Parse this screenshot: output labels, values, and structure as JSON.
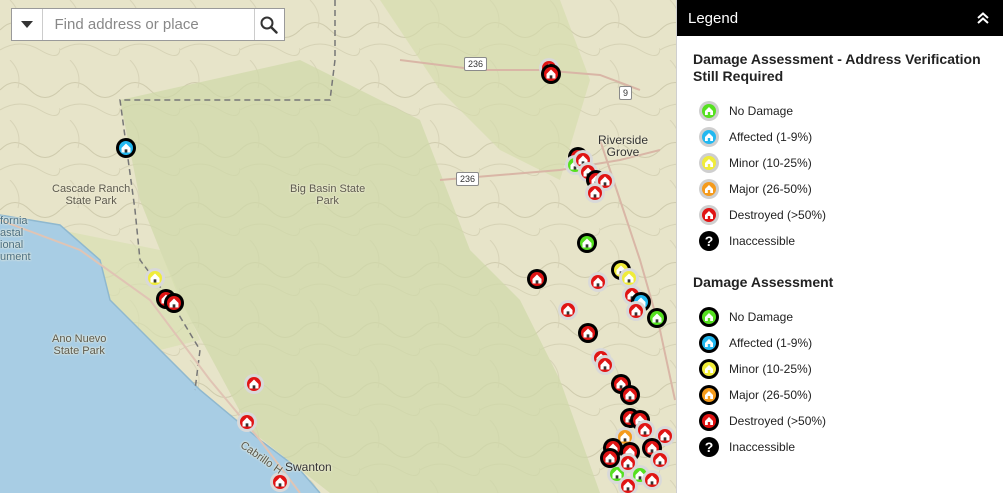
{
  "search": {
    "placeholder": "Find address or place"
  },
  "legend": {
    "title": "Legend",
    "groups": [
      {
        "title": "Damage Assessment - Address Verification Still Required",
        "items": [
          {
            "label": "No Damage",
            "color": "#55e020"
          },
          {
            "label": "Affected (1-9%)",
            "color": "#22b8f0"
          },
          {
            "label": "Minor (10-25%)",
            "color": "#f0ec3a"
          },
          {
            "label": "Major (26-50%)",
            "color": "#f59b1c"
          },
          {
            "label": "Destroyed (>50%)",
            "color": "#e01414"
          },
          {
            "label": "Inaccessible",
            "color": "#000000"
          }
        ]
      },
      {
        "title": "Damage Assessment",
        "items": [
          {
            "label": "No Damage",
            "color": "#55e020"
          },
          {
            "label": "Affected (1-9%)",
            "color": "#22b8f0"
          },
          {
            "label": "Minor (10-25%)",
            "color": "#f0ec3a"
          },
          {
            "label": "Major (26-50%)",
            "color": "#f59b1c"
          },
          {
            "label": "Destroyed (>50%)",
            "color": "#e01414"
          },
          {
            "label": "Inaccessible",
            "color": "#000000"
          }
        ]
      }
    ]
  },
  "map": {
    "labels": {
      "cascade_ranch": "Cascade Ranch\nState Park",
      "big_basin": "Big Basin State\nPark",
      "riverside_grove": "Riverside\nGrove",
      "ano_nuevo": "Ano Nuevo\nState Park",
      "swanton": "Swanton",
      "california": "fornia\nastal\nional\nument",
      "cabrillo": "Cabrillo H"
    },
    "routes": {
      "r236_a": "236",
      "r236_b": "236",
      "r9": "9"
    }
  }
}
